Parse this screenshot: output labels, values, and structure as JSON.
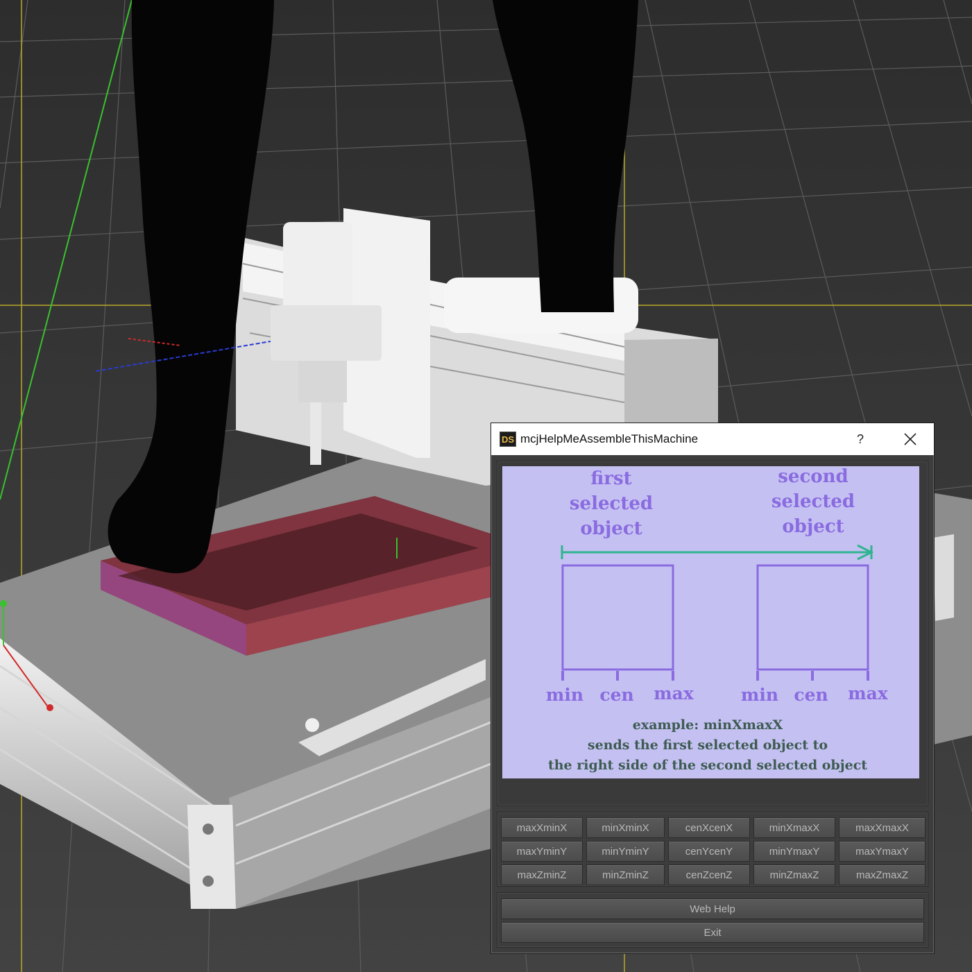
{
  "dialog": {
    "app_icon": "DS",
    "title": "mcjHelpMeAssembleThisMachine",
    "help_label": "?",
    "close_icon": "close-icon"
  },
  "diagram": {
    "first_lines": [
      "first",
      "selected",
      "object"
    ],
    "second_lines": [
      "second",
      "selected",
      "object"
    ],
    "axis_labels": [
      "min",
      "cen",
      "max"
    ],
    "example_lines": [
      "example: minXmaxX",
      "sends the first selected object to",
      "the right side of the second selected object"
    ],
    "colors": {
      "background": "#c4c1f2",
      "box": "#8a6be0",
      "arrow": "#2fb48f",
      "example_text": "#3e5b52"
    }
  },
  "buttons": {
    "rows": [
      [
        "maxXminX",
        "minXminX",
        "cenXcenX",
        "minXmaxX",
        "maxXmaxX"
      ],
      [
        "maxYminY",
        "minYminY",
        "cenYcenY",
        "minYmaxY",
        "maxYmaxY"
      ],
      [
        "maxZminZ",
        "minZminZ",
        "cenZcenZ",
        "minZmaxZ",
        "maxZmaxZ"
      ]
    ]
  },
  "actions": {
    "web_help": "Web Help",
    "exit": "Exit"
  }
}
